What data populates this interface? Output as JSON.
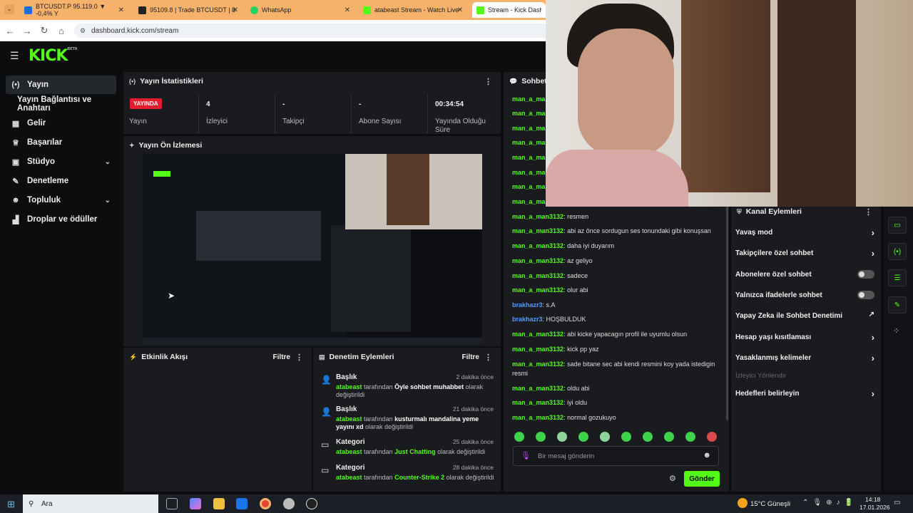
{
  "browser": {
    "tabs": [
      {
        "label": "BTCUSDT.P 95.119.0 ▼ -0,4% Y",
        "color": "#1e6fd9"
      },
      {
        "label": "95109.8 | Trade BTCUSDT | 8",
        "color": "#222"
      },
      {
        "label": "WhatsApp",
        "color": "#25d366"
      },
      {
        "label": "atabeast Stream - Watch Live o",
        "color": "#53fc18"
      },
      {
        "label": "Stream - Kick Dashboard",
        "color": "#53fc18"
      }
    ],
    "url": "dashboard.kick.com/stream"
  },
  "app": {
    "logo": "KICK",
    "logo_tag": "BETA",
    "sidebar": [
      {
        "label": "Yayın",
        "icon": "broadcast-icon",
        "glyph": "(•)",
        "chev": ""
      },
      {
        "label": "Yayın Bağlantısı ve Anahtarı",
        "icon": "",
        "glyph": "",
        "chev": ""
      },
      {
        "label": "Gelir",
        "icon": "revenue-icon",
        "glyph": "▦",
        "chev": ""
      },
      {
        "label": "Başarılar",
        "icon": "trophy-icon",
        "glyph": "♕",
        "chev": ""
      },
      {
        "label": "Stüdyo",
        "icon": "studio-icon",
        "glyph": "▣",
        "chev": "⌄"
      },
      {
        "label": "Denetleme",
        "icon": "wrench-icon",
        "glyph": "✎",
        "chev": ""
      },
      {
        "label": "Topluluk",
        "icon": "community-icon",
        "glyph": "☻",
        "chev": "⌄"
      },
      {
        "label": "Droplar ve ödüller",
        "icon": "drops-icon",
        "glyph": "▟",
        "chev": ""
      }
    ]
  },
  "stats": {
    "title": "Yayın İstatistikleri",
    "live_badge": "YAYINDA",
    "live_label": "Yayın",
    "items": [
      {
        "value": "4",
        "label": "İzleyici"
      },
      {
        "value": "-",
        "label": "Takipçi"
      },
      {
        "value": "-",
        "label": "Abone Sayısı"
      },
      {
        "value": "00:34:54",
        "label": "Yayında Olduğu Süre"
      }
    ]
  },
  "preview": {
    "title": "Yayın Ön İzlemesi"
  },
  "activity": {
    "title": "Etkinlik Akışı",
    "filter": "Filtre"
  },
  "mod_actions": {
    "title": "Denetim Eylemleri",
    "filter": "Filtre",
    "by": "tarafından",
    "items": [
      {
        "type": "Başlık",
        "time": "2 dakika önce",
        "user": "atabeast",
        "value": "Öyle sohbet muhabbet",
        "tail": "olarak değiştirildi"
      },
      {
        "type": "Başlık",
        "time": "21 dakika önce",
        "user": "atabeast",
        "value": "kusturmalı mandalina yeme yayını xd",
        "tail": "olarak değiştirildi"
      },
      {
        "type": "Kategori",
        "time": "25 dakika önce",
        "user": "atabeast",
        "value": "Just Chatting",
        "tail": "olarak değiştirildi"
      },
      {
        "type": "Kategori",
        "time": "28 dakika önce",
        "user": "atabeast",
        "value": "Counter-Strike 2",
        "tail": "olarak değiştirildi"
      }
    ]
  },
  "chat": {
    "title": "Sohbet",
    "hidden_user": "man_a_man",
    "messages": [
      {
        "user": "man_a_man3132",
        "text": "resmen",
        "blue": false
      },
      {
        "user": "man_a_man3132",
        "text": "abi az önce sordugun ses tonundaki gibi konuşsan",
        "blue": false
      },
      {
        "user": "man_a_man3132",
        "text": "daha iyi duyarım",
        "blue": false
      },
      {
        "user": "man_a_man3132",
        "text": "az geliyo",
        "blue": false
      },
      {
        "user": "man_a_man3132",
        "text": "sadece",
        "blue": false
      },
      {
        "user": "man_a_man3132",
        "text": "olur abi",
        "blue": false
      },
      {
        "user": "brakhazr3",
        "text": "s.A",
        "blue": true
      },
      {
        "user": "brakhazr3",
        "text": "HOŞBULDUK",
        "blue": true
      },
      {
        "user": "man_a_man3132",
        "text": "abi kicke yapacagın profil ile uyumlu olsun",
        "blue": false
      },
      {
        "user": "man_a_man3132",
        "text": "kick pp yaz",
        "blue": false
      },
      {
        "user": "man_a_man3132",
        "text": "sade bitane sec abi kendi resmini koy yada istedigin resmi",
        "blue": false
      },
      {
        "user": "man_a_man3132",
        "text": "oldu abi",
        "blue": false
      },
      {
        "user": "man_a_man3132",
        "text": "iyi oldu",
        "blue": false
      },
      {
        "user": "man_a_man3132",
        "text": "normal gozukuyo",
        "blue": false
      }
    ],
    "placeholder": "Bir mesaj gönderin",
    "send": "Gönder"
  },
  "channel_actions": {
    "title": "Kanal Eylemleri",
    "items": [
      {
        "label": "Yavaş mod",
        "kind": "arrow"
      },
      {
        "label": "Takipçilere özel sohbet",
        "kind": "arrow"
      },
      {
        "label": "Abonelere özel sohbet",
        "kind": "toggle"
      },
      {
        "label": "Yalnızca ifadelerle sohbet",
        "kind": "toggle"
      },
      {
        "label": "Yapay Zeka ile Sohbet Denetimi",
        "kind": "external"
      },
      {
        "label": "Hesap yaşı kısıtlaması",
        "kind": "arrow"
      },
      {
        "label": "Yasaklanmış kelimeler",
        "kind": "arrow"
      },
      {
        "label": "İzleyici Yönlendir",
        "kind": "disabled"
      },
      {
        "label": "Hedefleri belirleyin",
        "kind": "arrow"
      }
    ]
  },
  "taskbar": {
    "search": "Ara",
    "weather": "15°C Güneşli",
    "time": "14:18",
    "date": "17.01.2026"
  }
}
